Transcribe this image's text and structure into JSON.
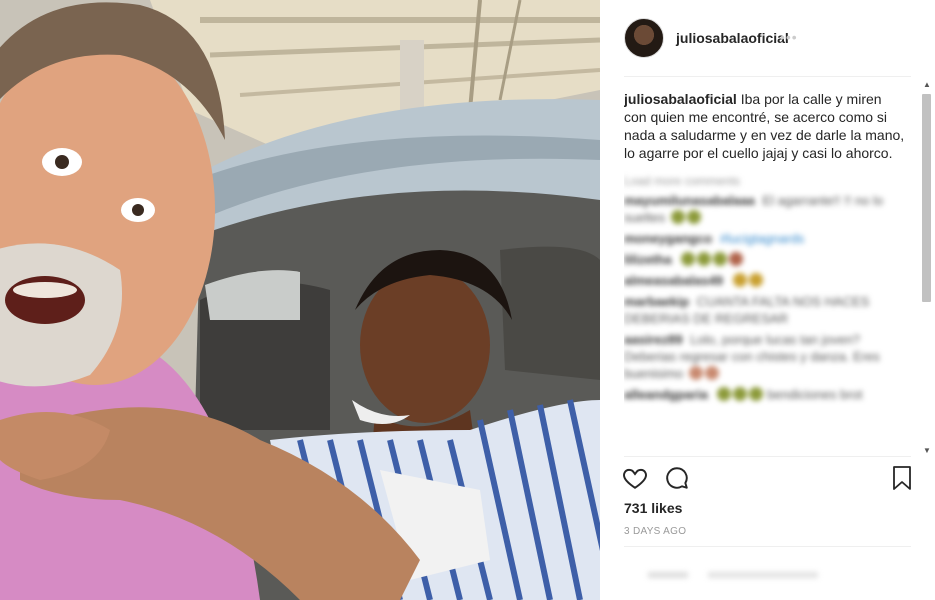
{
  "post": {
    "username": "juliosabalaoficial",
    "caption": "Iba por la calle y miren con quien me encontré, se acerco como si nada a saludarme y en vez de darle la mano, lo agarre por el cuello jajaj y casi lo ahorco.",
    "load_more": "Load more comments",
    "likes": "731 likes",
    "timestamp": "3 DAYS AGO"
  },
  "comments": [
    {
      "user": "mayumilunasabalaaa",
      "text": "El agarrante!! !! no lo sueltes"
    },
    {
      "user": "moneygangco",
      "text": "#lucigtagnards"
    },
    {
      "user": "lilizetha",
      "text": ""
    },
    {
      "user": "almeasabalas49",
      "text": ""
    },
    {
      "user": "marbaekip",
      "text": "CUANTA FALTA NOS HACES DEBERIAS DE REGRESAR"
    },
    {
      "user": "aasirez89",
      "text": "Lolo, porque lucas tan joven? Deberias regresar con chistes y danza. Eres buenisimo"
    },
    {
      "user": "alleandgparia",
      "text": "bendiciones brot"
    }
  ],
  "icons": {
    "like": "heart-icon",
    "comment": "comment-bubble-icon",
    "save": "bookmark-icon",
    "more": "more-dots-icon"
  }
}
